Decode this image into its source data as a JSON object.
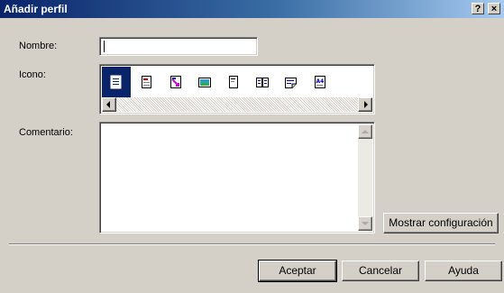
{
  "window": {
    "title": "Añadir perfil",
    "help_btn": "?",
    "close_btn": "×"
  },
  "form": {
    "name_label": "Nombre:",
    "name_value": "",
    "icon_label": "Icono:",
    "icons": [
      "page-icon",
      "document-icon",
      "arrow-image-icon",
      "picture-icon",
      "note-icon",
      "two-pages-icon",
      "booklet-icon",
      "a4-icon"
    ],
    "comment_label": "Comentario:",
    "comment_value": ""
  },
  "buttons": {
    "show_settings": "Mostrar configuración",
    "ok": "Aceptar",
    "cancel": "Cancelar",
    "help": "Ayuda"
  }
}
